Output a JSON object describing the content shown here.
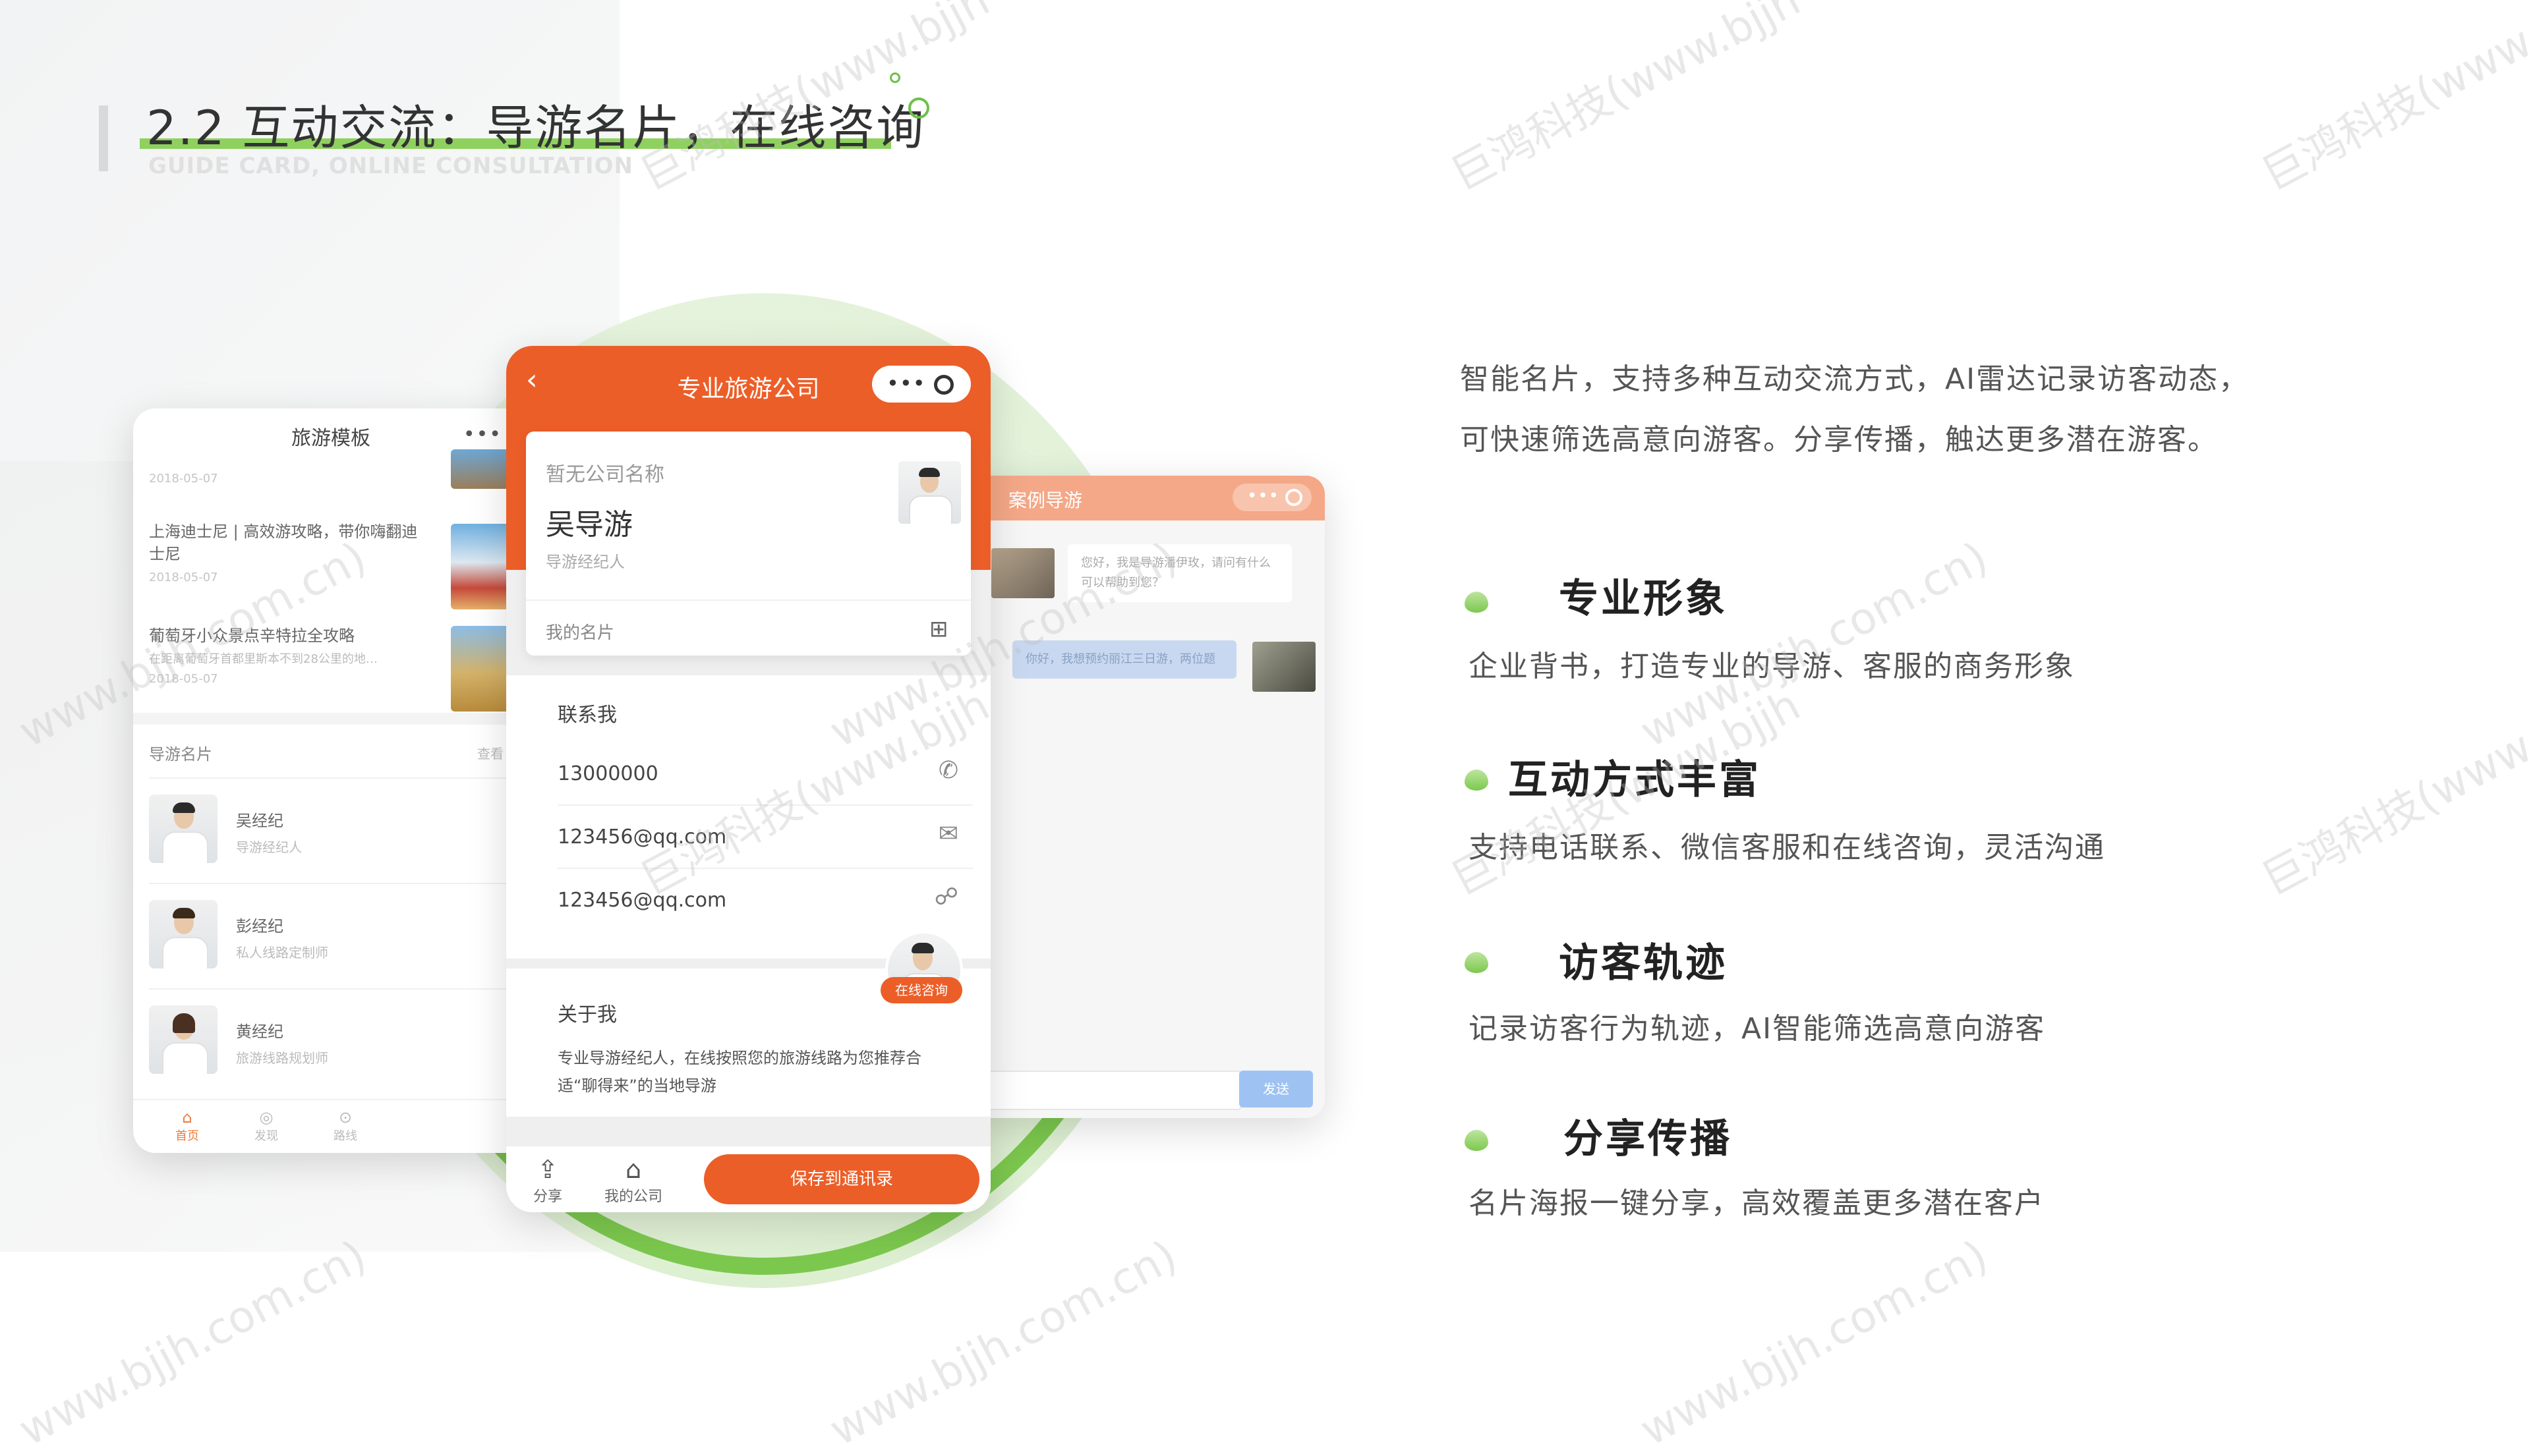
{
  "slide": {
    "title": "2.2 互动交流：导游名片，在线咨询",
    "subtitle": "GUIDE CARD, ONLINE CONSULTATION"
  },
  "left_phone": {
    "header_title": "旅游模板",
    "menu_icon": "more-dots-icon",
    "news": [
      {
        "title": "",
        "date": "2018-05-07"
      },
      {
        "title": "上海迪士尼 | 高效游攻略，带你嗨翻迪士尼",
        "date": "2018-05-07"
      },
      {
        "title": "葡萄牙小众景点辛特拉全攻略",
        "summary": "在距离葡萄牙首都里斯本不到28公里的地…",
        "date": "2018-05-07"
      }
    ],
    "section_title": "导游名片",
    "section_more": "查看",
    "guides": [
      {
        "name": "吴经纪",
        "role": "导游经纪人"
      },
      {
        "name": "彭经纪",
        "role": "私人线路定制师"
      },
      {
        "name": "黄经纪",
        "role": "旅游线路规划师"
      }
    ],
    "tabs": [
      {
        "label": "首页",
        "icon": "home-icon"
      },
      {
        "label": "发现",
        "icon": "eye-icon"
      },
      {
        "label": "路线",
        "icon": "location-icon"
      }
    ]
  },
  "chat_window": {
    "header_title": "案例导游",
    "messages": [
      {
        "side": "in",
        "text": "您好，我是导游潘伊玫，请问有什么可以帮助到您？"
      },
      {
        "side": "out",
        "text": "你好，我想预约丽江三日游，两位题"
      }
    ],
    "send_label": "发送"
  },
  "center_phone": {
    "header_title": "专业旅游公司",
    "company_name": "暂无公司名称",
    "guide_name": "吴导游",
    "guide_role": "导游经纪人",
    "my_card_label": "我的名片",
    "contact_title": "联系我",
    "contacts": [
      {
        "value": "13000000",
        "icon": "phone-icon"
      },
      {
        "value": "123456@qq.com",
        "icon": "mail-icon"
      },
      {
        "value": "123456@qq.com",
        "icon": "wechat-icon"
      }
    ],
    "online_consult_label": "在线咨询",
    "about_title": "关于我",
    "about_text": "专业导游经纪人，在线按照您的旅游线路为您推荐合适“聊得来”的当地导游",
    "share_label": "分享",
    "my_company_label": "我的公司",
    "save_label": "保存到通讯录"
  },
  "intro_text": [
    "智能名片，支持多种互动交流方式，AI雷达记录访客动态，",
    "可快速筛选高意向游客。分享传播，触达更多潜在游客。"
  ],
  "features": [
    {
      "title": "专业形象",
      "desc": "企业背书，打造专业的导游、客服的商务形象"
    },
    {
      "title": "互动方式丰富",
      "desc": "支持电话联系、微信客服和在线咨询，灵活沟通"
    },
    {
      "title": "访客轨迹",
      "desc": "记录访客行为轨迹，AI智能筛选高意向游客"
    },
    {
      "title": "分享传播",
      "desc": "名片海报一键分享，高效覆盖更多潜在客户"
    }
  ],
  "watermarks": {
    "cn": "巨鸿科技(www.bjjh",
    "url": "www.bjjh.com.cn)"
  },
  "colors": {
    "accent_orange": "#ec5e28",
    "accent_green": "#7cc84e"
  }
}
